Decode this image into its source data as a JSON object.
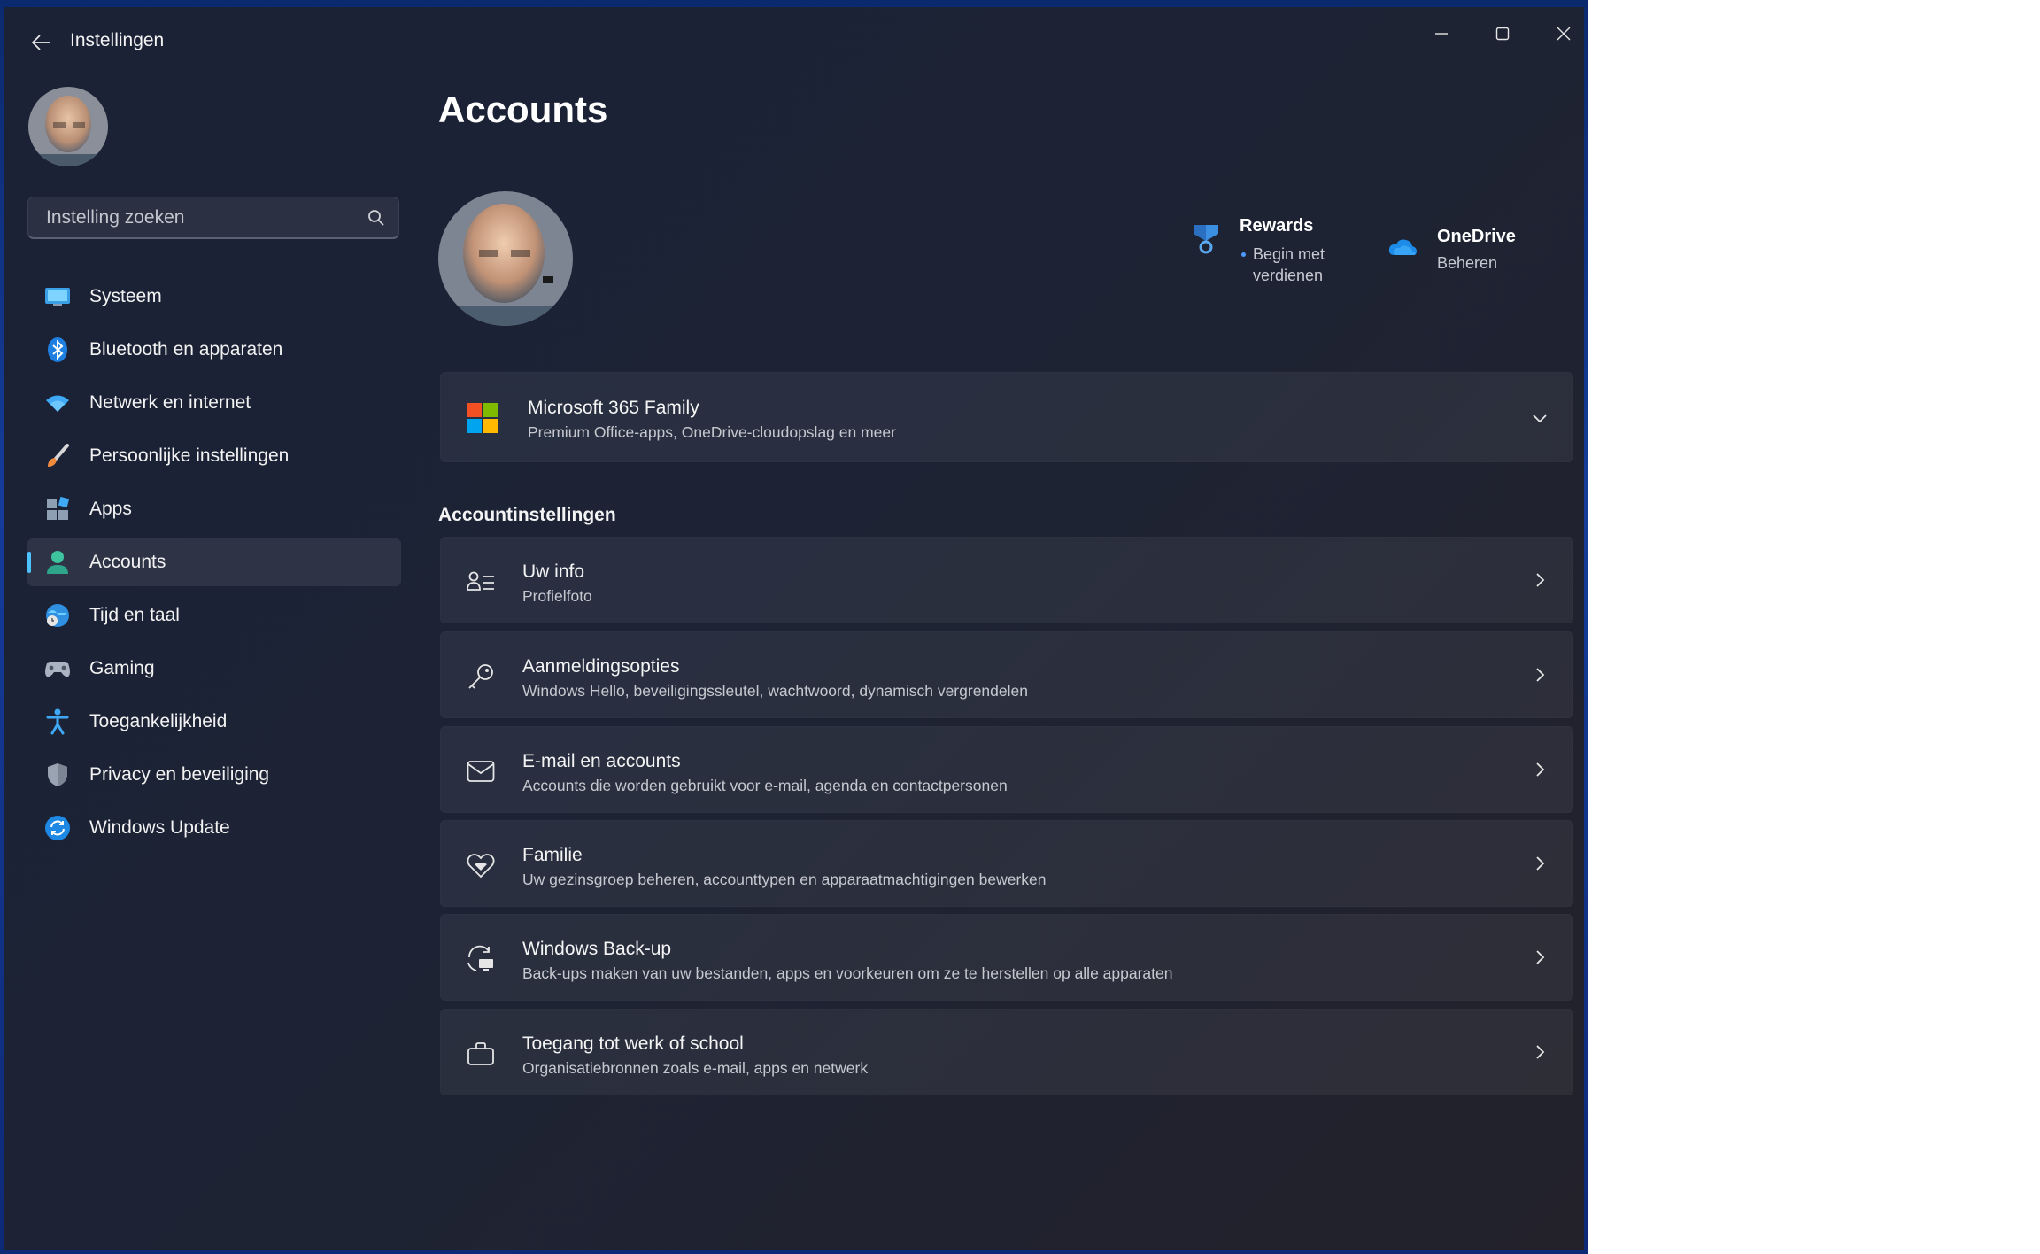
{
  "window": {
    "title": "Instellingen"
  },
  "search": {
    "placeholder": "Instelling zoeken"
  },
  "sidebar": {
    "items": [
      {
        "label": "Systeem",
        "icon": "display-icon"
      },
      {
        "label": "Bluetooth en apparaten",
        "icon": "bluetooth-icon"
      },
      {
        "label": "Netwerk en internet",
        "icon": "wifi-icon"
      },
      {
        "label": "Persoonlijke instellingen",
        "icon": "paintbrush-icon"
      },
      {
        "label": "Apps",
        "icon": "apps-icon"
      },
      {
        "label": "Accounts",
        "icon": "person-icon",
        "active": true
      },
      {
        "label": "Tijd en taal",
        "icon": "globe-clock-icon"
      },
      {
        "label": "Gaming",
        "icon": "gamepad-icon"
      },
      {
        "label": "Toegankelijkheid",
        "icon": "accessibility-icon"
      },
      {
        "label": "Privacy en beveiliging",
        "icon": "shield-icon"
      },
      {
        "label": "Windows Update",
        "icon": "update-icon"
      }
    ]
  },
  "main": {
    "title": "Accounts",
    "rewards": {
      "title": "Rewards",
      "subtitle": "Begin met verdienen"
    },
    "onedrive": {
      "title": "OneDrive",
      "subtitle": "Beheren"
    },
    "subscription": {
      "title": "Microsoft 365 Family",
      "subtitle": "Premium Office-apps, OneDrive-cloudopslag en meer"
    },
    "section_title": "Accountinstellingen",
    "cards": [
      {
        "title": "Uw info",
        "subtitle": "Profielfoto",
        "icon": "contact-card-icon"
      },
      {
        "title": "Aanmeldingsopties",
        "subtitle": "Windows Hello, beveiligingssleutel, wachtwoord, dynamisch vergrendelen",
        "icon": "key-icon"
      },
      {
        "title": "E-mail en accounts",
        "subtitle": "Accounts die worden gebruikt voor e-mail, agenda en contactpersonen",
        "icon": "mail-icon"
      },
      {
        "title": "Familie",
        "subtitle": "Uw gezinsgroep beheren, accounttypen en apparaatmachtigingen bewerken",
        "icon": "family-heart-icon"
      },
      {
        "title": "Windows Back-up",
        "subtitle": "Back-ups maken van uw bestanden, apps en voorkeuren om ze te herstellen op alle apparaten",
        "icon": "backup-icon"
      },
      {
        "title": "Toegang tot werk of school",
        "subtitle": "Organisatiebronnen zoals e-mail, apps en netwerk",
        "icon": "briefcase-icon"
      }
    ]
  },
  "colors": {
    "accent": "#4cc2ff",
    "window_bg": "#1c2233",
    "card_bg": "#262b3b"
  }
}
